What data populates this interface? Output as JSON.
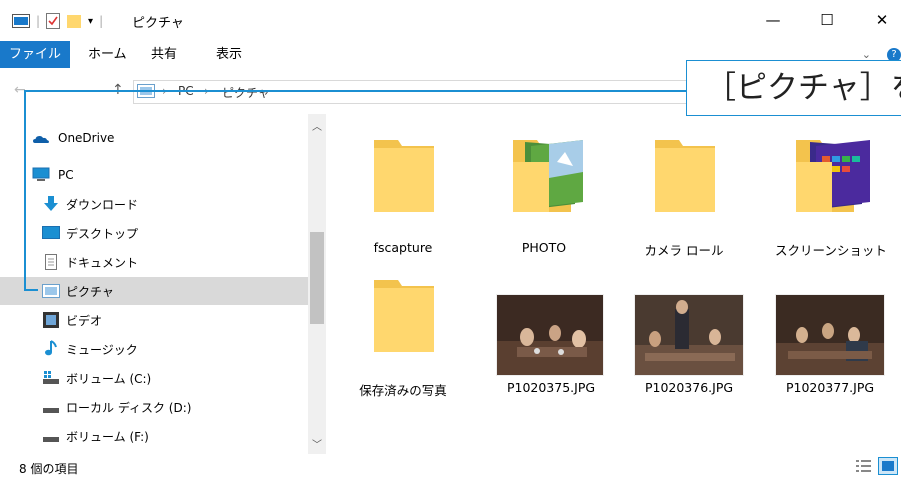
{
  "window": {
    "title": "ピクチャ",
    "controls": {
      "minimize": "—",
      "maximize": "☐",
      "close": "✕"
    }
  },
  "ribbon": {
    "tabs": [
      "ファイル",
      "ホーム",
      "共有",
      "表示"
    ],
    "collapse_glyph": "⌄",
    "help_glyph": "?"
  },
  "address": {
    "breadcrumbs": [
      "PC",
      "ピクチャ"
    ],
    "separator": "›"
  },
  "callout": {
    "text": "［ピクチャ］を"
  },
  "nav": {
    "items": [
      {
        "label": "OneDrive",
        "icon": "onedrive-icon"
      },
      {
        "label": "PC",
        "icon": "pc-icon"
      },
      {
        "label": "ダウンロード",
        "icon": "download-icon"
      },
      {
        "label": "デスクトップ",
        "icon": "desktop-icon"
      },
      {
        "label": "ドキュメント",
        "icon": "document-icon"
      },
      {
        "label": "ピクチャ",
        "icon": "pictures-icon",
        "selected": true
      },
      {
        "label": "ビデオ",
        "icon": "video-icon"
      },
      {
        "label": "ミュージック",
        "icon": "music-icon"
      },
      {
        "label": "ボリューム (C:)",
        "icon": "drive-c-icon"
      },
      {
        "label": "ローカル ディスク (D:)",
        "icon": "drive-d-icon"
      },
      {
        "label": "ボリューム (F:)",
        "icon": "drive-f-icon"
      }
    ]
  },
  "files": [
    {
      "name": "fscapture",
      "kind": "folder"
    },
    {
      "name": "PHOTO",
      "kind": "folder-photo"
    },
    {
      "name": "カメラ ロール",
      "kind": "folder"
    },
    {
      "name": "スクリーンショット",
      "kind": "folder-screens"
    },
    {
      "name": "保存済みの写真",
      "kind": "folder"
    },
    {
      "name": "P1020375.JPG",
      "kind": "jpg"
    },
    {
      "name": "P1020376.JPG",
      "kind": "jpg"
    },
    {
      "name": "P1020377.JPG",
      "kind": "jpg"
    }
  ],
  "status": {
    "count_text": "8 個の項目"
  },
  "colors": {
    "accent": "#1979ca",
    "callout_border": "#1b8fd2",
    "folder": "#ffd76e",
    "selected_row": "#d9d9d9"
  }
}
